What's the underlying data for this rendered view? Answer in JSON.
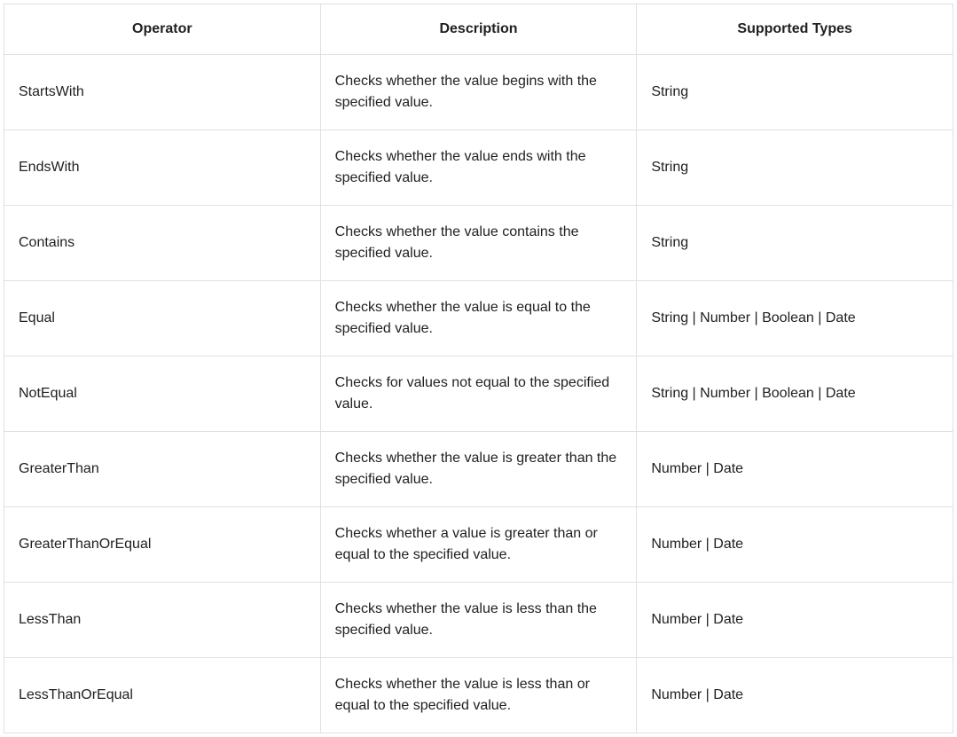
{
  "table": {
    "headers": {
      "operator": "Operator",
      "description": "Description",
      "supported_types": "Supported Types"
    },
    "rows": [
      {
        "operator": "StartsWith",
        "description": "Checks whether the value begins with the specified value.",
        "supported_types": "String"
      },
      {
        "operator": "EndsWith",
        "description": "Checks whether the value ends with the specified value.",
        "supported_types": "String"
      },
      {
        "operator": "Contains",
        "description": "Checks whether the value contains the specified value.",
        "supported_types": "String"
      },
      {
        "operator": "Equal",
        "description": "Checks whether the value is equal to the specified value.",
        "supported_types": "String | Number | Boolean | Date"
      },
      {
        "operator": "NotEqual",
        "description": "Checks for values not equal to the specified value.",
        "supported_types": "String | Number | Boolean | Date"
      },
      {
        "operator": "GreaterThan",
        "description": "Checks whether the value is greater than the specified value.",
        "supported_types": "Number | Date"
      },
      {
        "operator": "GreaterThanOrEqual",
        "description": "Checks whether a value is greater than or equal to the specified value.",
        "supported_types": "Number | Date"
      },
      {
        "operator": "LessThan",
        "description": "Checks whether the value is less than the specified value.",
        "supported_types": "Number | Date"
      },
      {
        "operator": "LessThanOrEqual",
        "description": "Checks whether the value is less than or equal to the specified value.",
        "supported_types": "Number | Date"
      }
    ]
  }
}
